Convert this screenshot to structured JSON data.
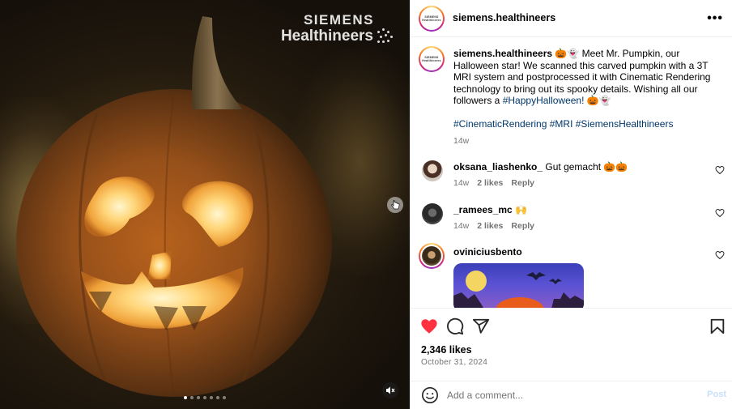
{
  "media": {
    "brand_line1": "SIEMENS",
    "brand_line2": "Healthineers",
    "dots_total": 7,
    "dots_active": 0,
    "mute_icon": "speaker-muted-icon",
    "next_icon": "hand-cursor-icon"
  },
  "post": {
    "username": "siemens.healthineers",
    "caption_username": "siemens.healthineers",
    "caption_text": " 🎃👻 Meet Mr. Pumpkin, our Halloween star! We scanned this carved pumpkin with a 3T MRI system and postprocessed it with Cinematic Rendering technology to bring out its spooky details. Wishing all our followers a ",
    "caption_tag": "#HappyHalloween!",
    "caption_tail": " 🎃👻",
    "hashtags": "#CinematicRendering #MRI #SiemensHealthineers",
    "caption_time": "14w",
    "likes": "2,346 likes",
    "date": "October 31, 2024"
  },
  "comments": [
    {
      "user": "oksana_liashenko_",
      "text": " Gut gemacht 🎃🎃",
      "time": "14w",
      "likes": "2 likes",
      "reply": "Reply"
    },
    {
      "user": "_ramees_mc",
      "text": " 🙌",
      "time": "14w",
      "likes": "2 likes",
      "reply": "Reply"
    },
    {
      "user": "oviniciusbento",
      "text": ""
    }
  ],
  "composer": {
    "placeholder": "Add a comment...",
    "post_label": "Post"
  },
  "colors": {
    "like_red": "#ff3040",
    "hashtag_blue": "#00376b",
    "muted_gray": "#737373",
    "post_disabled": "#c7dffa"
  }
}
